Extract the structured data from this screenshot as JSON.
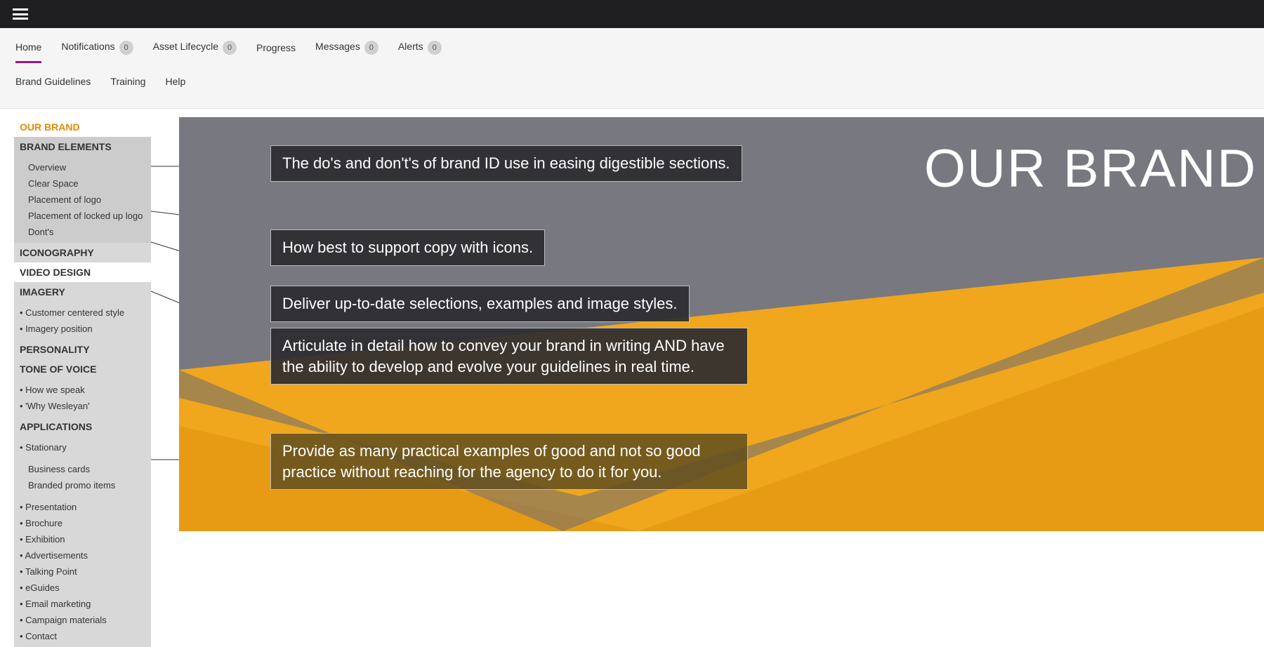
{
  "topnav": {
    "row1": [
      {
        "label": "Home",
        "active": true,
        "badge": null
      },
      {
        "label": "Notifications",
        "badge": "0"
      },
      {
        "label": "Asset Lifecycle",
        "badge": "0"
      },
      {
        "label": "Progress",
        "badge": null
      },
      {
        "label": "Messages",
        "badge": "0"
      },
      {
        "label": "Alerts",
        "badge": "0"
      }
    ],
    "row2": [
      {
        "label": "Brand Guidelines"
      },
      {
        "label": "Training"
      },
      {
        "label": "Help"
      }
    ]
  },
  "sidebar": [
    {
      "type": "head",
      "cls": "orange",
      "label": "OUR BRAND"
    },
    {
      "type": "head",
      "cls": "grey",
      "label": "BRAND ELEMENTS"
    },
    {
      "type": "group",
      "cls": "",
      "items": [
        "Overview",
        "Clear Space",
        "Placement of logo",
        "Placement of locked up logo",
        "Dont's"
      ]
    },
    {
      "type": "head",
      "cls": "light",
      "label": "ICONOGRAPHY"
    },
    {
      "type": "head",
      "cls": "white",
      "label": "VIDEO DESIGN"
    },
    {
      "type": "head",
      "cls": "light",
      "label": "IMAGERY"
    },
    {
      "type": "group",
      "cls": "light",
      "bullets": true,
      "items": [
        "Customer centered style",
        "Imagery position"
      ]
    },
    {
      "type": "head",
      "cls": "light",
      "label": "PERSONALITY"
    },
    {
      "type": "head",
      "cls": "light",
      "label": "TONE OF VOICE"
    },
    {
      "type": "group",
      "cls": "light",
      "bullets": true,
      "items": [
        "How we speak",
        "'Why Wesleyan'"
      ]
    },
    {
      "type": "head",
      "cls": "light",
      "label": "APPLICATIONS"
    },
    {
      "type": "group",
      "cls": "light",
      "bullets": true,
      "items": [
        "Stationary"
      ]
    },
    {
      "type": "group",
      "cls": "light",
      "items": [
        "Business cards",
        "Branded promo items"
      ]
    },
    {
      "type": "group",
      "cls": "light",
      "bullets": true,
      "items": [
        "Presentation",
        "Brochure",
        "Exhibition",
        "Advertisements",
        "Talking Point",
        "eGuides",
        "Email marketing",
        "Campaign materials",
        "Contact"
      ]
    }
  ],
  "hero": {
    "title": "OUR BRAND",
    "callouts": [
      "The do's and don't's of brand ID use in easing digestible sections.",
      "How best to support copy with icons.",
      "Deliver up-to-date selections, examples and image styles.",
      "Articulate in detail how to convey your brand in writing AND have the ability to develop and evolve your guidelines in real time.",
      "Provide as many practical examples of good and not so good practice without reaching for the agency to do it for you."
    ]
  }
}
